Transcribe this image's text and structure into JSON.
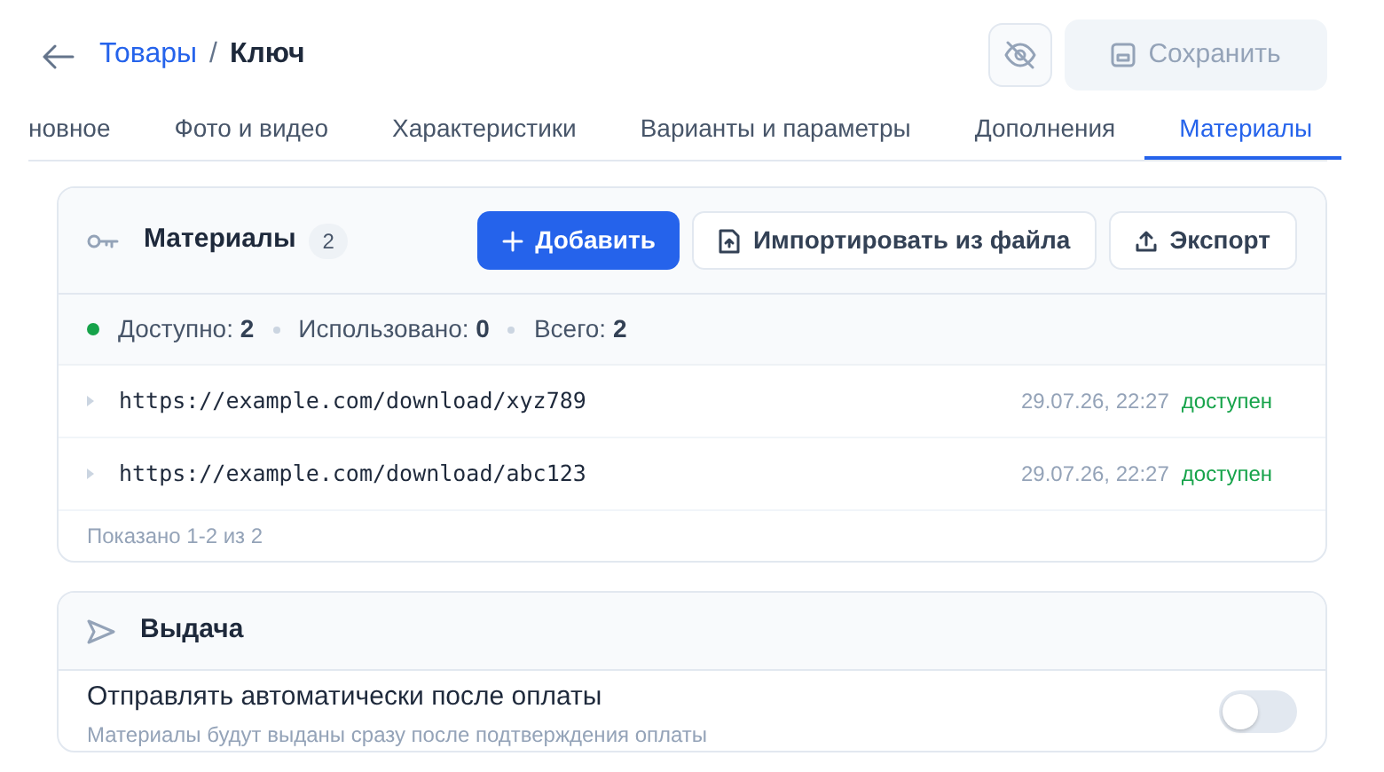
{
  "breadcrumb": {
    "parent": "Товары",
    "separator": "/",
    "current": "Ключ"
  },
  "save_button": {
    "label": "Сохранить",
    "disabled": true
  },
  "tabs": [
    {
      "label": "новное",
      "selected": false
    },
    {
      "label": "Фото и видео",
      "selected": false
    },
    {
      "label": "Характеристики",
      "selected": false
    },
    {
      "label": "Варианты и параметры",
      "selected": false
    },
    {
      "label": "Дополнения",
      "selected": false
    },
    {
      "label": "Материалы",
      "selected": true
    }
  ],
  "materials": {
    "title": "Материалы",
    "count": "2",
    "add_button": "Добавить",
    "import_button": "Импортировать из файла",
    "export_button": "Экспорт",
    "stats": [
      {
        "label": "Доступно:",
        "value": "2",
        "color": "#16a34a"
      },
      {
        "label": "Использовано:",
        "value": "0"
      },
      {
        "label": "Всего:",
        "value": "2"
      }
    ],
    "rows": [
      {
        "url": "https://example.com/download/xyz789",
        "date": "29.07.26, 22:27",
        "status": "доступен"
      },
      {
        "url": "https://example.com/download/abc123",
        "date": "29.07.26, 22:27",
        "status": "доступен"
      }
    ],
    "footer": "Показано 1-2 из 2"
  },
  "delivery": {
    "title": "Выдача",
    "setting": {
      "label": "Отправлять автоматически после оплаты",
      "description": "Материалы будут выданы сразу после подтверждения оплаты",
      "on": false
    }
  }
}
